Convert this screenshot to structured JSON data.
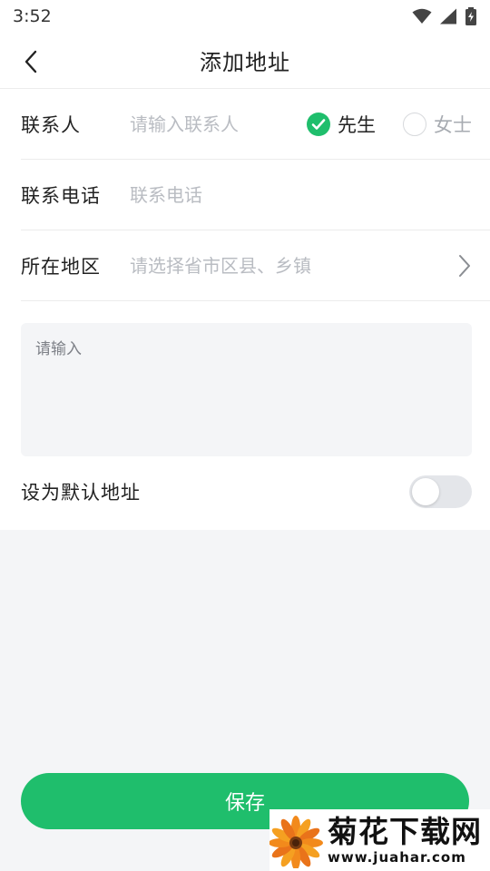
{
  "status_bar": {
    "time": "3:52"
  },
  "header": {
    "title": "添加地址",
    "back_icon": "chevron-left-icon"
  },
  "form": {
    "contact": {
      "label": "联系人",
      "placeholder": "请输入联系人"
    },
    "gender": {
      "options": [
        {
          "label": "先生",
          "selected": true
        },
        {
          "label": "女士",
          "selected": false
        }
      ]
    },
    "phone": {
      "label": "联系电话",
      "placeholder": "联系电话"
    },
    "region": {
      "label": "所在地区",
      "placeholder": "请选择省市区县、乡镇"
    },
    "detail": {
      "placeholder": "请输入"
    },
    "default_address": {
      "label": "设为默认地址",
      "enabled": false
    }
  },
  "save_button": {
    "label": "保存"
  },
  "watermark": {
    "title": "菊花下载网",
    "url": "www.juahar.com"
  },
  "colors": {
    "accent": "#1fbe6c",
    "background": "#f4f5f7",
    "placeholder": "#b9bcc2"
  }
}
